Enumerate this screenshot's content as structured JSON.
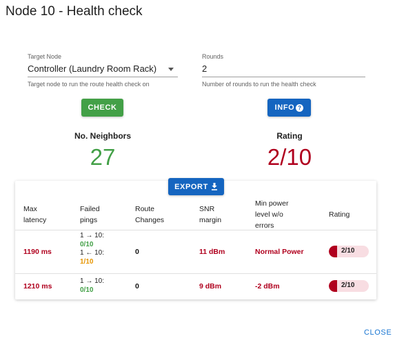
{
  "dialog": {
    "title": "Node 10 - Health check",
    "close_label": "CLOSE"
  },
  "target_node": {
    "label": "Target Node",
    "value": "Controller (Laundry Room Rack)",
    "hint": "Target node to run the route health check on"
  },
  "rounds": {
    "label": "Rounds",
    "value": "2",
    "hint": "Number of rounds to run the health check"
  },
  "buttons": {
    "check": "CHECK",
    "info": "INFO",
    "export": "EXPORT"
  },
  "stats": {
    "neighbors_label": "No. Neighbors",
    "neighbors_value": "27",
    "rating_label": "Rating",
    "rating_value": "2/10"
  },
  "table": {
    "headers": {
      "max_latency": [
        "Max",
        "latency"
      ],
      "failed_pings": [
        "Failed",
        "pings"
      ],
      "route_changes": [
        "Route",
        "Changes"
      ],
      "snr_margin": [
        "SNR",
        "margin"
      ],
      "min_power": [
        "Min power",
        "level w/o",
        "errors"
      ],
      "rating": [
        "Rating"
      ]
    },
    "rows": [
      {
        "max_latency": "1190 ms",
        "pings": [
          {
            "dir": "1 → 10:",
            "value": "0/10"
          },
          {
            "dir": "1 ← 10:",
            "value": "1/10"
          }
        ],
        "route_changes": "0",
        "snr_margin": "11 dBm",
        "min_power": "Normal Power",
        "rating": "2/10",
        "rating_fraction": 0.2
      },
      {
        "max_latency": "1210 ms",
        "pings": [
          {
            "dir": "1 → 10:",
            "value": "0/10"
          }
        ],
        "route_changes": "0",
        "snr_margin": "9 dBm",
        "min_power": "-2 dBm",
        "rating": "2/10",
        "rating_fraction": 0.2
      }
    ]
  },
  "colors": {
    "good_green": "#43a047",
    "bad_red": "#b0001e",
    "warn_orange": "#e69500",
    "primary_blue": "#1565c0"
  }
}
